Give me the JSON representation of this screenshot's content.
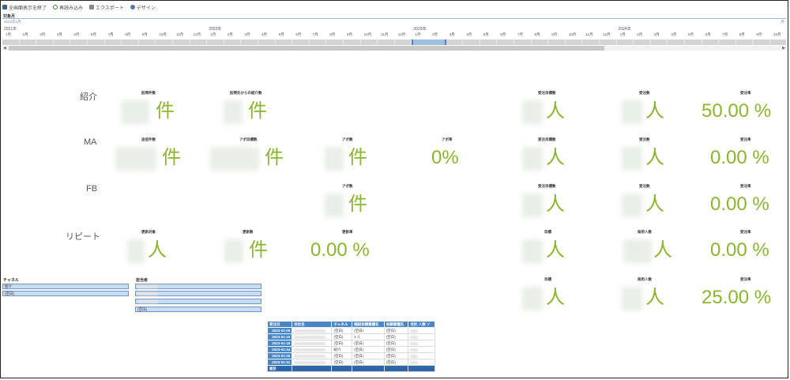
{
  "toolbar": {
    "fullscreen_exit": "全画面表示を終了",
    "reload": "再読み込み",
    "export": "エクスポート",
    "design": "デザイン"
  },
  "timeline": {
    "label": "対象月",
    "range_text": "2023年1月",
    "all_text": "月",
    "years": [
      "2021年",
      "2022年",
      "2023年",
      "2024年"
    ],
    "months": [
      "1月",
      "2月",
      "3月",
      "4月",
      "5月",
      "6月",
      "7月",
      "8月",
      "9月",
      "10月",
      "11月",
      "12月",
      "1月",
      "2月",
      "3月",
      "4月",
      "5月",
      "6月",
      "7月",
      "8月",
      "9月",
      "10月",
      "11月",
      "12月",
      "1月",
      "2月",
      "3月",
      "4月",
      "5月",
      "6月",
      "7月",
      "8月",
      "9月",
      "10月",
      "11月",
      "12月",
      "1月",
      "2月",
      "3月",
      "4月",
      "5月",
      "6月",
      "7月",
      "8月",
      "9月",
      "10月"
    ],
    "selected_months": [
      24,
      25
    ]
  },
  "rows": {
    "introduction": {
      "label": "紹介",
      "visit_count": {
        "title": "訪問件数",
        "unit": "件"
      },
      "referrals_from_visits": {
        "title": "訪問先からの紹介数",
        "unit": "件"
      },
      "order_target": {
        "title": "受注目標数",
        "unit": "人"
      },
      "orders": {
        "title": "受注数",
        "unit": "人"
      },
      "order_rate": {
        "title": "受注率",
        "value": "50.00 %"
      }
    },
    "ma": {
      "label": "MA",
      "sent_count": {
        "title": "送信件数",
        "unit": "件"
      },
      "appointment_target": {
        "title": "アポ目標数",
        "unit": "件"
      },
      "appointments": {
        "title": "アポ数",
        "unit": "件"
      },
      "appointment_rate": {
        "title": "アポ率",
        "value": "0%"
      },
      "order_target": {
        "title": "受注目標数",
        "unit": "人"
      },
      "orders": {
        "title": "受注数",
        "unit": "人"
      },
      "order_rate": {
        "title": "受注率",
        "value": "0.00 %"
      }
    },
    "fb": {
      "label": "FB",
      "appointments": {
        "title": "アポ数",
        "unit": "件"
      },
      "order_target": {
        "title": "受注目標数",
        "unit": "人"
      },
      "orders": {
        "title": "受注数",
        "unit": "人"
      },
      "order_rate": {
        "title": "受注率",
        "value": "0.00 %"
      }
    },
    "repeat": {
      "label": "リピート",
      "renewal_targets": {
        "title": "更新対象",
        "unit": "人"
      },
      "renewals": {
        "title": "更新数",
        "unit": "件"
      },
      "renewal_rate": {
        "title": "更新率",
        "value": "0.00 %"
      },
      "goal": {
        "title": "目標",
        "unit": "人"
      },
      "hired": {
        "title": "採用人数",
        "unit": "人"
      },
      "order_rate": {
        "title": "受注率",
        "value": "0.00 %"
      }
    },
    "extra": {
      "goal": {
        "title": "目標",
        "unit": "人"
      },
      "hired": {
        "title": "採用人数",
        "unit": "人"
      },
      "order_rate": {
        "title": "受注率",
        "value": "25.00 %"
      }
    }
  },
  "filters": {
    "channel": {
      "title": "チャネル",
      "items": [
        "紹介",
        "(空白)"
      ]
    },
    "person_in_charge": {
      "title": "担当者",
      "items": [
        "",
        "",
        "",
        "(空白)"
      ]
    }
  },
  "table": {
    "headers": [
      "受注日",
      "会社名",
      "チャネル",
      "個紹依頼業種名",
      "依頼業種名",
      "合計 人数"
    ],
    "rows": [
      {
        "date": "2023-01-06",
        "channel": "(空白)",
        "industry": "(空白)",
        "industry2": "(空白)"
      },
      {
        "date": "2023-01-10",
        "channel": "(空白)",
        "industry": "2 人",
        "industry2": "(空白)"
      },
      {
        "date": "2023-01-18",
        "channel": "(空白)",
        "industry": "(空白)",
        "industry2": "(空白)"
      },
      {
        "date": "2023-01-24",
        "channel": "紹介",
        "industry": "(空白)",
        "industry2": "(空白)"
      },
      {
        "date": "2023-01-25",
        "channel": "(空白)",
        "industry": "(空白)",
        "industry2": "(空白)"
      },
      {
        "date": "2023-01-31",
        "channel": "(空白)",
        "industry": "(空白)",
        "industry2": "(空白)"
      }
    ],
    "total_label": "総計"
  }
}
